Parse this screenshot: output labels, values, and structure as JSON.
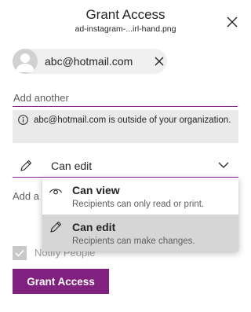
{
  "header": {
    "title": "Grant Access",
    "filename": "ad-instagram-...irl-hand.png"
  },
  "recipient": {
    "email": "abc@hotmail.com"
  },
  "add_recipient": {
    "placeholder": "Add another"
  },
  "warning": {
    "text": "abc@hotmail.com is outside of your organization."
  },
  "permission": {
    "selected_label": "Can edit"
  },
  "message": {
    "placeholder": "Add a message"
  },
  "dropdown": {
    "options": [
      {
        "title": "Can view",
        "description": "Recipients can only read or print.",
        "icon": "eye-icon"
      },
      {
        "title": "Can edit",
        "description": "Recipients can make changes.",
        "icon": "pencil-icon"
      }
    ],
    "selected": "Can edit"
  },
  "notify": {
    "label": "Notify People",
    "checked": true
  },
  "footer": {
    "grant_label": "Grant Access"
  },
  "colors": {
    "accent": "#80217f",
    "accent_underline": "#8a2593",
    "info_bg": "#eaeaea",
    "selected_bg": "#d6d6d6"
  }
}
